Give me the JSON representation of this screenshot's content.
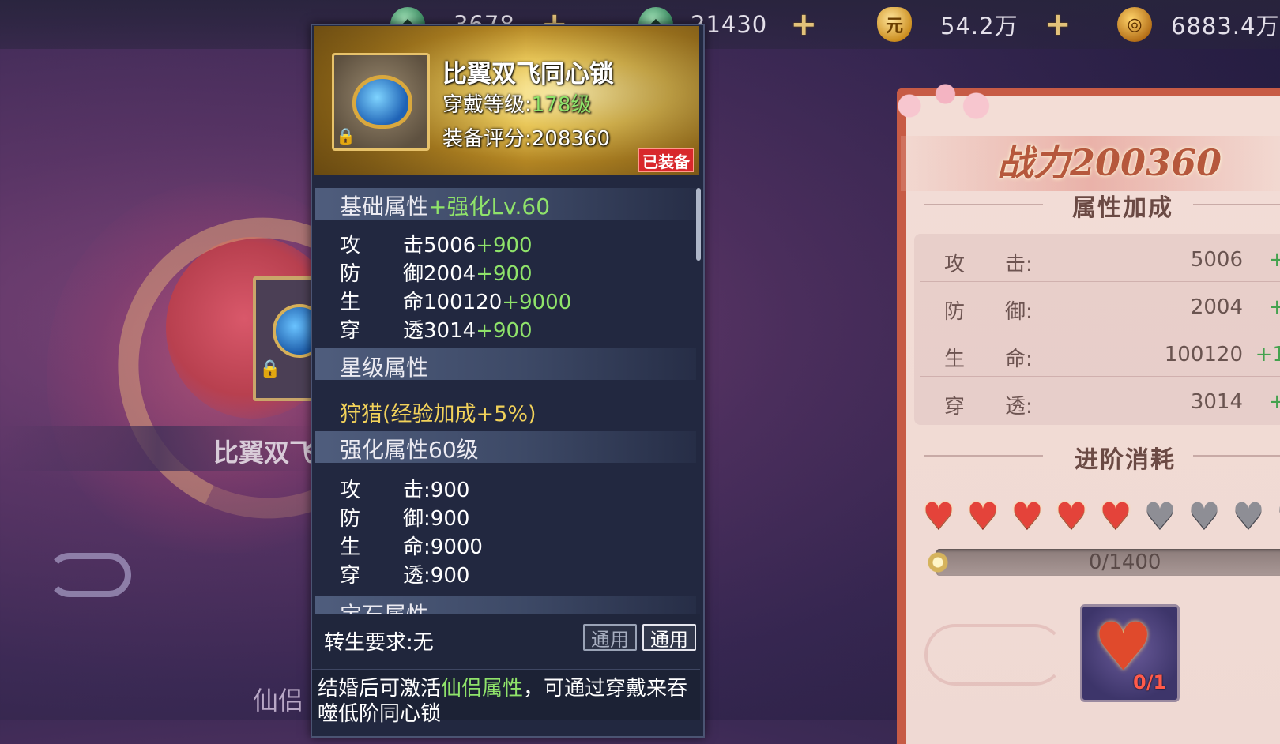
{
  "currency_bar": [
    {
      "icon": "jade-icon",
      "value": "3678",
      "has_plus": true
    },
    {
      "icon": "jade-icon",
      "value": "21430",
      "has_plus": true
    },
    {
      "icon": "ingot-icon",
      "value": "54.2万",
      "has_plus": true
    },
    {
      "icon": "coin-icon",
      "value": "6883.4万",
      "has_plus": false
    }
  ],
  "background": {
    "item_name": "比翼双飞",
    "tab_label": "仙侣"
  },
  "tooltip": {
    "item_name": "比翼双飞同心锁",
    "level_label": "穿戴等级:",
    "level_value": "178级",
    "score_label": "装备评分:",
    "score_value": "208360",
    "equipped_badge": "已装备",
    "base_section": {
      "title": "基础属性",
      "enhance": "+强化Lv.60",
      "stats": [
        {
          "k": "攻",
          "k2": "击",
          "value": "5006",
          "add": "+900"
        },
        {
          "k": "防",
          "k2": "御",
          "value": "2004",
          "add": "+900"
        },
        {
          "k": "生",
          "k2": "命",
          "value": "100120",
          "add": "+9000"
        },
        {
          "k": "穿",
          "k2": "透",
          "value": "3014",
          "add": "+900"
        }
      ]
    },
    "star_section": {
      "title": "星级属性",
      "text": "狩猎(经验加成+5%)"
    },
    "enhance_section": {
      "title": "强化属性60级",
      "stats": [
        {
          "k": "攻",
          "k2": "击",
          "value": ":900"
        },
        {
          "k": "防",
          "k2": "御",
          "value": ":900"
        },
        {
          "k": "生",
          "k2": "命",
          "value": ":9000"
        },
        {
          "k": "穿",
          "k2": "透",
          "value": ":900"
        }
      ]
    },
    "gem_section_title": "宝石属性",
    "rebirth_requirement": "转生要求:无",
    "button_ghost": "通用",
    "button_solid": "通用",
    "desc_prefix": "结婚后可激活",
    "desc_highlight": "仙侣属性",
    "desc_suffix": "，可通过穿戴来吞噬低阶同心锁"
  },
  "right_panel": {
    "power": "战力200360",
    "attr_title": "属性加成",
    "attrs": [
      {
        "k": "攻",
        "k2": "击:",
        "value": "5006",
        "plus": "+"
      },
      {
        "k": "防",
        "k2": "御:",
        "value": "2004",
        "plus": "+"
      },
      {
        "k": "生",
        "k2": "命:",
        "value": "100120",
        "plus": "+1"
      },
      {
        "k": "穿",
        "k2": "透:",
        "value": "3014",
        "plus": "+"
      }
    ],
    "advance_title": "进阶消耗",
    "hearts_lit": 5,
    "hearts_total": 9,
    "progress": "0/1400",
    "progress_fraction": 0,
    "item_count": "0/1"
  },
  "colors": {
    "accent_green": "#8fe36a",
    "accent_gold": "#f2d25a",
    "badge_red": "#d8282c",
    "panel_frame": "#c75b45"
  }
}
